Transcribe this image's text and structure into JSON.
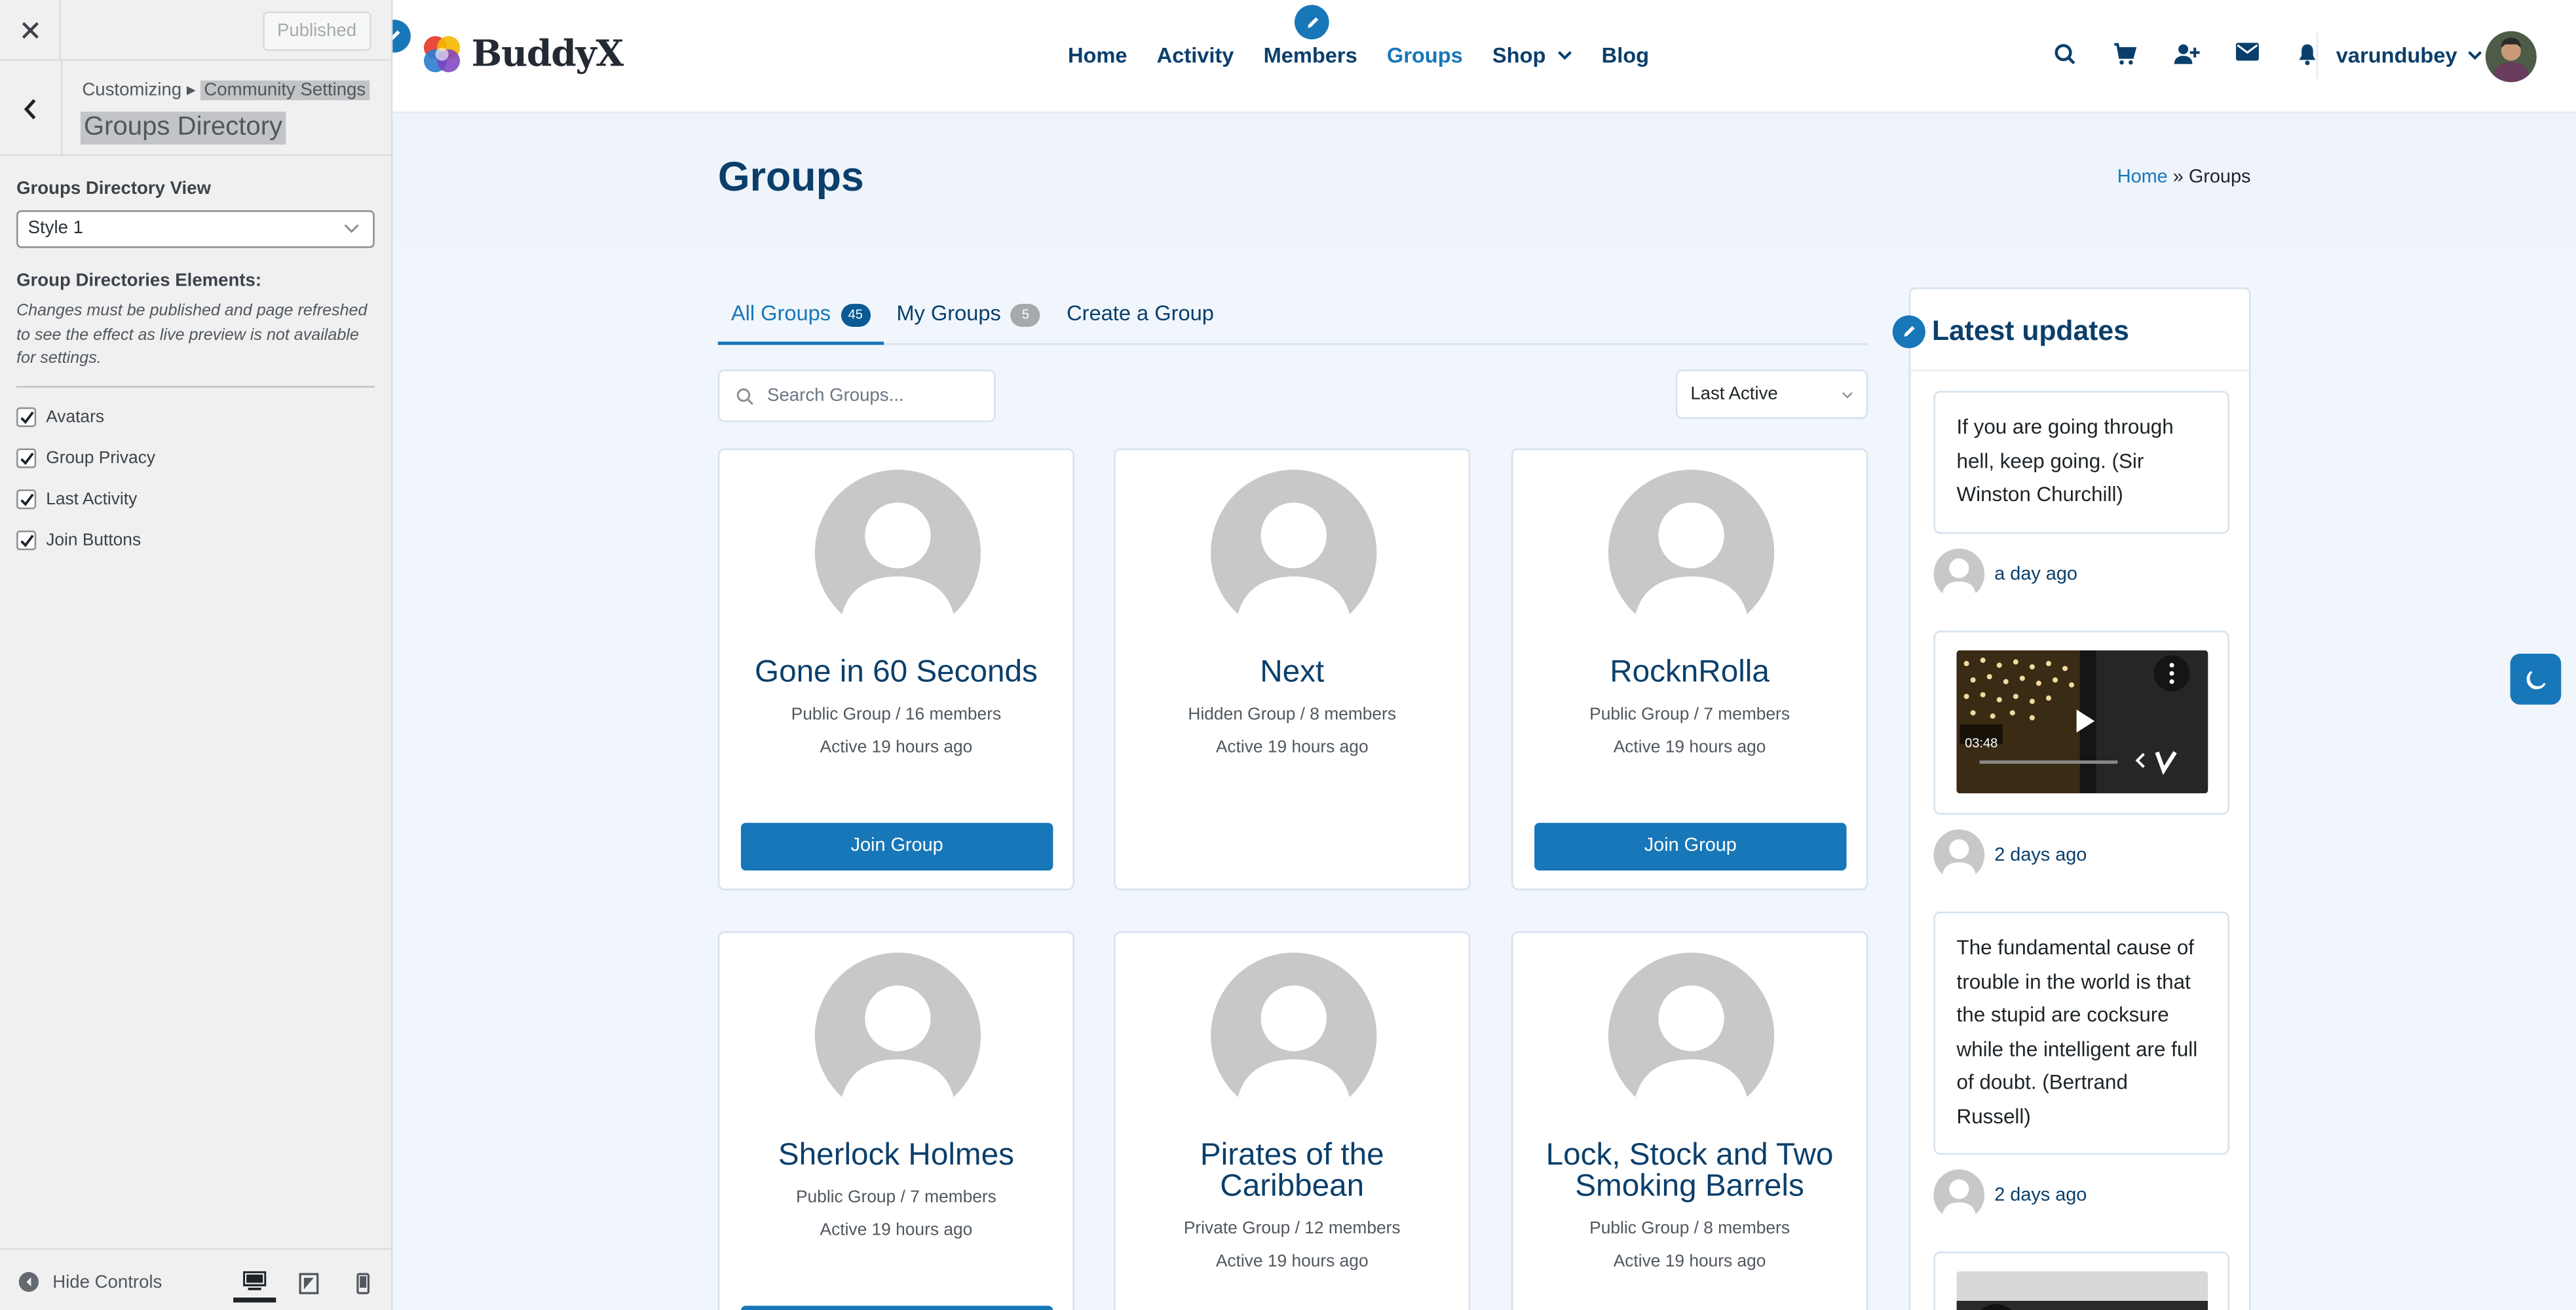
{
  "customizer": {
    "published_label": "Published",
    "breadcrumb_prefix": "Customizing",
    "breadcrumb_section": "Community Settings",
    "panel_title": "Groups Directory",
    "view_label": "Groups Directory View",
    "view_value": "Style 1",
    "elements_label": "Group Directories Elements:",
    "elements_desc": "Changes must be published and page refreshed to see the effect as live preview is not available for settings.",
    "checkboxes": [
      {
        "label": "Avatars",
        "checked": true
      },
      {
        "label": "Group Privacy",
        "checked": true
      },
      {
        "label": "Last Activity",
        "checked": true
      },
      {
        "label": "Join Buttons",
        "checked": true
      }
    ],
    "hide_controls": "Hide Controls"
  },
  "site": {
    "logo": "BuddyX",
    "nav": [
      "Home",
      "Activity",
      "Members",
      "Groups",
      "Shop",
      "Blog"
    ],
    "active_nav": "Groups",
    "username": "varundubey",
    "page_title": "Groups",
    "breadcrumb": {
      "home": "Home",
      "sep": "»",
      "current": "Groups"
    }
  },
  "groups": {
    "tabs": [
      {
        "label": "All Groups",
        "count": "45"
      },
      {
        "label": "My Groups",
        "count": "5"
      },
      {
        "label": "Create a Group"
      }
    ],
    "search_placeholder": "Search Groups...",
    "sort_value": "Last Active",
    "cards": [
      {
        "name": "Gone in 60 Seconds",
        "meta": "Public Group / 16 members",
        "active": "Active 19 hours ago",
        "button": "Join Group"
      },
      {
        "name": "Next",
        "meta": "Hidden Group / 8 members",
        "active": "Active 19 hours ago"
      },
      {
        "name": "RocknRolla",
        "meta": "Public Group / 7 members",
        "active": "Active 19 hours ago",
        "button": "Join Group"
      },
      {
        "name": "Sherlock Holmes",
        "meta": "Public Group / 7 members",
        "active": "Active 19 hours ago"
      },
      {
        "name_line1": "Pirates of the",
        "name_line2": "Caribbean",
        "meta": "Private Group / 12 members",
        "active": "Active 19 hours ago"
      },
      {
        "name_line1": "Lock, Stock and Two",
        "name_line2": "Smoking Barrels",
        "meta": "Public Group / 8 members",
        "active": "Active 19 hours ago"
      }
    ]
  },
  "sidebar": {
    "title": "Latest updates",
    "updates": [
      {
        "text": "If you are going through hell, keep going. (Sir Winston Churchill)",
        "time": "a day ago"
      },
      {
        "video_time": "03:48",
        "time": "2 days ago"
      },
      {
        "text": "The fundamental cause of trouble in the world is that the stupid are cocksure while the intelligent are full of doubt. (Bertrand Russell)",
        "time": "2 days ago"
      }
    ]
  },
  "colors": {
    "primary": "#1777b8",
    "heading": "#0b3f6b",
    "bg": "#f0f6fc"
  }
}
